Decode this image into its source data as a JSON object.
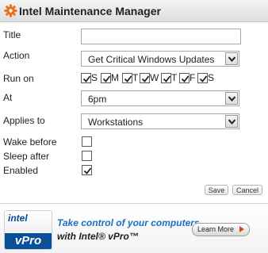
{
  "app": {
    "title": "Intel Maintenance Manager",
    "icon": "gear-icon",
    "icon_color": "#e8721c"
  },
  "form": {
    "title_label": "Title",
    "title_value": "",
    "action_label": "Action",
    "action_value": "Get Critical Windows Updates",
    "run_on_label": "Run on",
    "days": [
      {
        "label": "S",
        "checked": true
      },
      {
        "label": "M",
        "checked": true
      },
      {
        "label": "T",
        "checked": true
      },
      {
        "label": "W",
        "checked": true
      },
      {
        "label": "T",
        "checked": true
      },
      {
        "label": "F",
        "checked": true
      },
      {
        "label": "S",
        "checked": true
      }
    ],
    "at_label": "At",
    "at_value": "6pm",
    "applies_label": "Applies to",
    "applies_value": "Workstations",
    "wake_label": "Wake before",
    "wake_checked": false,
    "sleep_label": "Sleep after",
    "sleep_checked": false,
    "enabled_label": "Enabled",
    "enabled_checked": true
  },
  "buttons": {
    "save": "Save",
    "cancel": "Cancel"
  },
  "banner": {
    "logo_top": "intel",
    "logo_bottom": "vPro",
    "line1": "Take control of your computers",
    "line2": "with Intel® vPro™",
    "learn_more": "Learn More",
    "accent_color": "#1d6fc4"
  }
}
